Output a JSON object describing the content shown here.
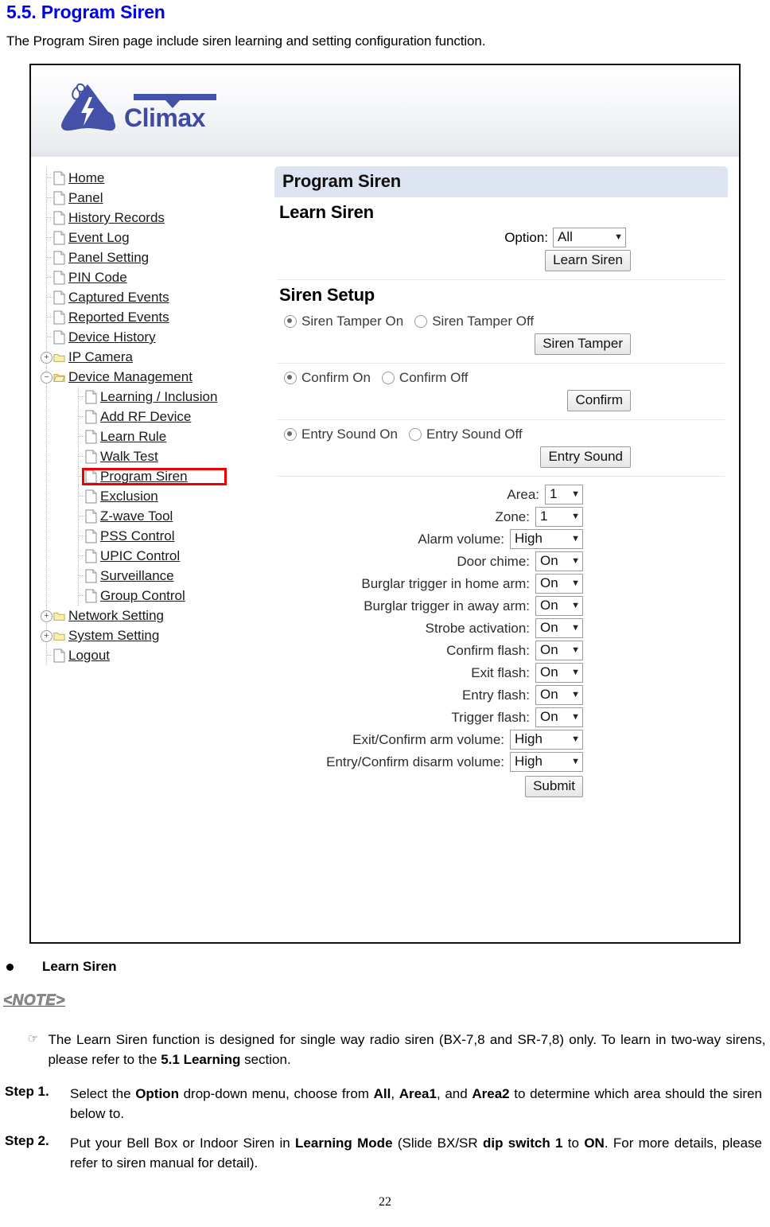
{
  "document": {
    "heading": "5.5. Program Siren",
    "intro": "The Program Siren page include siren learning and setting configuration function.",
    "bullet_label": "Learn Siren",
    "note_tag": "<NOTE>",
    "note_text_prefix": "The Learn Siren function is designed for single way radio siren (BX-7,8 and SR-7,8) only. To learn in two-way sirens, please refer to the ",
    "note_text_bold": "5.1 Learning",
    "note_text_suffix": " section.",
    "steps": [
      {
        "label": "Step 1.",
        "parts": [
          {
            "text": "Select the ",
            "bold": false
          },
          {
            "text": "Option",
            "bold": true
          },
          {
            "text": " drop-down menu, choose from ",
            "bold": false
          },
          {
            "text": "All",
            "bold": true
          },
          {
            "text": ", ",
            "bold": false
          },
          {
            "text": "Area1",
            "bold": true
          },
          {
            "text": ", and ",
            "bold": false
          },
          {
            "text": "Area2",
            "bold": true
          },
          {
            "text": " to determine which area should the siren below to.",
            "bold": false
          }
        ]
      },
      {
        "label": "Step 2.",
        "parts": [
          {
            "text": "Put your Bell Box or Indoor Siren in ",
            "bold": false
          },
          {
            "text": "Learning Mode",
            "bold": true
          },
          {
            "text": " (Slide BX/SR ",
            "bold": false
          },
          {
            "text": "dip switch 1",
            "bold": true
          },
          {
            "text": " to ",
            "bold": false
          },
          {
            "text": "ON",
            "bold": true
          },
          {
            "text": ". For more details, please refer to siren manual for detail).",
            "bold": false
          }
        ]
      }
    ],
    "page_number": "22"
  },
  "screenshot": {
    "brand": {
      "name": "Climax",
      "logo_icon": "climax-mountain-logo",
      "color": "#3f4ba3"
    },
    "nav": {
      "items": [
        {
          "label": "Home",
          "type": "page",
          "level": 0,
          "toggle": null
        },
        {
          "label": "Panel",
          "type": "page",
          "level": 0,
          "toggle": null
        },
        {
          "label": "History Records",
          "type": "page",
          "level": 0,
          "toggle": null
        },
        {
          "label": "Event Log",
          "type": "page",
          "level": 0,
          "toggle": null
        },
        {
          "label": "Panel Setting",
          "type": "page",
          "level": 0,
          "toggle": null
        },
        {
          "label": "PIN Code",
          "type": "page",
          "level": 0,
          "toggle": null
        },
        {
          "label": "Captured Events",
          "type": "page",
          "level": 0,
          "toggle": null
        },
        {
          "label": "Reported Events",
          "type": "page",
          "level": 0,
          "toggle": null
        },
        {
          "label": "Device History",
          "type": "page",
          "level": 0,
          "toggle": null
        },
        {
          "label": "IP Camera",
          "type": "folder",
          "level": 0,
          "toggle": "+"
        },
        {
          "label": "Device Management",
          "type": "folder-open",
          "level": 0,
          "toggle": "−"
        },
        {
          "label": "Learning / Inclusion",
          "type": "page",
          "level": 1,
          "toggle": null
        },
        {
          "label": "Add RF Device",
          "type": "page",
          "level": 1,
          "toggle": null
        },
        {
          "label": "Learn Rule",
          "type": "page",
          "level": 1,
          "toggle": null
        },
        {
          "label": "Walk Test",
          "type": "page",
          "level": 1,
          "toggle": null
        },
        {
          "label": "Program Siren",
          "type": "page",
          "level": 1,
          "toggle": null,
          "highlighted": true
        },
        {
          "label": "Exclusion",
          "type": "page",
          "level": 1,
          "toggle": null
        },
        {
          "label": "Z-wave Tool",
          "type": "page",
          "level": 1,
          "toggle": null
        },
        {
          "label": "PSS Control",
          "type": "page",
          "level": 1,
          "toggle": null
        },
        {
          "label": "UPIC Control",
          "type": "page",
          "level": 1,
          "toggle": null
        },
        {
          "label": "Surveillance",
          "type": "page",
          "level": 1,
          "toggle": null
        },
        {
          "label": "Group Control",
          "type": "page",
          "level": 1,
          "toggle": null
        },
        {
          "label": "Network Setting",
          "type": "folder",
          "level": 0,
          "toggle": "+"
        },
        {
          "label": "System Setting",
          "type": "folder",
          "level": 0,
          "toggle": "+"
        },
        {
          "label": "Logout",
          "type": "page",
          "level": 0,
          "toggle": null
        }
      ],
      "highlight_color": "#ef0000"
    },
    "main": {
      "page_title": "Program Siren",
      "learn_siren": {
        "heading": "Learn Siren",
        "option_label": "Option:",
        "option_value": "All",
        "button_label": "Learn Siren"
      },
      "siren_setup": {
        "heading": "Siren Setup",
        "groups": [
          {
            "on_label": "Siren Tamper On",
            "off_label": "Siren Tamper Off",
            "selected": "on",
            "button_label": "Siren Tamper"
          },
          {
            "on_label": "Confirm On",
            "off_label": "Confirm Off",
            "selected": "on",
            "button_label": "Confirm"
          },
          {
            "on_label": "Entry Sound On",
            "off_label": "Entry Sound Off",
            "selected": "on",
            "button_label": "Entry Sound"
          }
        ]
      },
      "settings": {
        "fields": [
          {
            "label": "Area:",
            "value": "1",
            "size": "sm"
          },
          {
            "label": "Zone:",
            "value": "1",
            "size": "md"
          },
          {
            "label": "Alarm volume:",
            "value": "High",
            "size": "lg"
          },
          {
            "label": "Door chime:",
            "value": "On",
            "size": "md"
          },
          {
            "label": "Burglar trigger in home arm:",
            "value": "On",
            "size": "md"
          },
          {
            "label": "Burglar trigger in away arm:",
            "value": "On",
            "size": "md"
          },
          {
            "label": "Strobe activation:",
            "value": "On",
            "size": "md"
          },
          {
            "label": "Confirm flash:",
            "value": "On",
            "size": "md"
          },
          {
            "label": "Exit flash:",
            "value": "On",
            "size": "md"
          },
          {
            "label": "Entry flash:",
            "value": "On",
            "size": "md"
          },
          {
            "label": "Trigger flash:",
            "value": "On",
            "size": "md"
          },
          {
            "label": "Exit/Confirm arm volume:",
            "value": "High",
            "size": "lg"
          },
          {
            "label": "Entry/Confirm disarm volume:",
            "value": "High",
            "size": "lg"
          }
        ],
        "submit_label": "Submit"
      }
    }
  }
}
